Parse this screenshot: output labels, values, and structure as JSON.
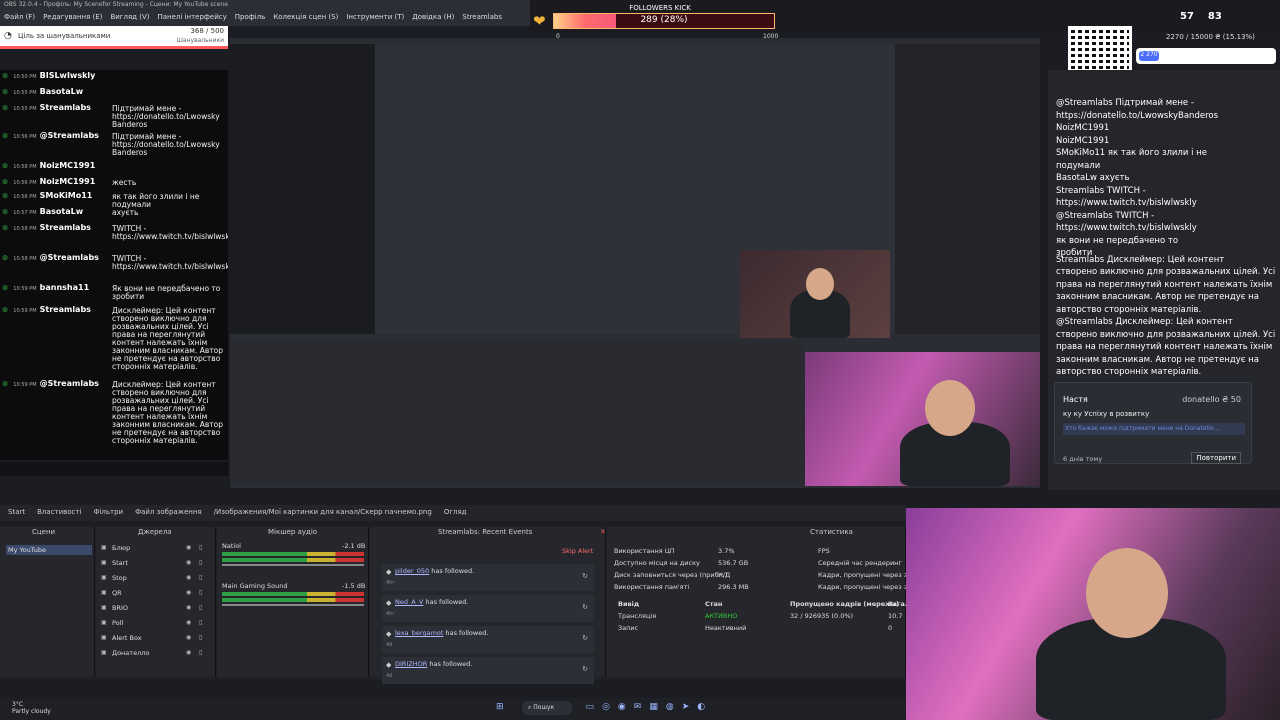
{
  "window": {
    "title": "OBS 32.0.4 - Профіль: My Scenefor Streaming - Сцени: My YouTube scene"
  },
  "menu": [
    "Файл (F)",
    "Редагування (E)",
    "Вигляд (V)",
    "Панелі інтерфейсу",
    "Профіль",
    "Колекція сцен (S)",
    "Інструменти (T)",
    "Довідка (H)",
    "Streamlabs"
  ],
  "followers_kick": {
    "title": "FOLLOWERS KICK",
    "progress_text": "289 (28%)",
    "progress_fraction": 0.28,
    "min": "0",
    "max": "1000"
  },
  "top_stats": {
    "a": "57",
    "b": "83"
  },
  "donation_goal": {
    "text": "2270 / 15000 ₴ (15.13%)",
    "badge": "2 270"
  },
  "sub_goal": {
    "label": "Ціль за шанувальниками",
    "count": "368 / 500",
    "sub": "Шанувальники"
  },
  "chat": [
    {
      "time": "10:50 PM",
      "name": "BISLwIwskly",
      "text": ""
    },
    {
      "time": "10:55 PM",
      "name": "BasotaLw",
      "text": ""
    },
    {
      "time": "10:55 PM",
      "name": "Streamlabs",
      "text": "Підтримай мене - https://donatello.to/Lwowsky Banderos"
    },
    {
      "time": "10:56 PM",
      "name": "@Streamlabs",
      "text": "Підтримай мене - https://donatello.to/Lwowsky Banderos"
    },
    {
      "time": "10:58 PM",
      "name": "NoizMC1991",
      "text": ""
    },
    {
      "time": "10:56 PM",
      "name": "NoizMC1991",
      "text": "жесть"
    },
    {
      "time": "10:56 PM",
      "name": "SMoKiMo11",
      "text": "як так його злили і не подумали"
    },
    {
      "time": "10:57 PM",
      "name": "BasotaLw",
      "text": "ахуєть"
    },
    {
      "time": "10:58 PM",
      "name": "Streamlabs",
      "text": "TWITCH - https://www.twitch.tv/bislwlwskly"
    },
    {
      "time": "10:58 PM",
      "name": "@Streamlabs",
      "text": "TWITCH - https://www.twitch.tv/bislwlwskly"
    },
    {
      "time": "10:59 PM",
      "name": "bannsha11",
      "text": "Як вони не передбачено то зробити"
    },
    {
      "time": "10:59 PM",
      "name": "Streamlabs",
      "text": "Дисклеймер: Цей контент створено виключно для розважальних цілей. Усі права на переглянутий контент належать їхнім законним власникам. Автор не претендує на авторство сторонніх матеріалів."
    },
    {
      "time": "10:59 PM",
      "name": "@Streamlabs",
      "text": "Дисклеймер: Цей контент створено виключно для розважальних цілей. Усі права на переглянутий контент належать їхнім законним власникам. Автор не претендує на авторство сторонніх матеріалів."
    }
  ],
  "right_chat": {
    "lines": [
      "@Streamlabs  Підтримай мене -",
      "https://donatello.to/LwowskyBanderos",
      "NoizMC1991",
      "NoizMC1991",
      "SMoKiMo11  як так його злили і не",
      "подумали",
      "BasotaLw  ахуєть",
      "Streamlabs  TWITCH -",
      "https://www.twitch.tv/bislwlwskly",
      "@Streamlabs  TWITCH -",
      "https://www.twitch.tv/bislwlwskly",
      "як вони не передбачено то",
      "зробити",
      "Streamlabs  Дисклеймер: Цей контент",
      "створено виключно для розважальних цілей. Усі",
      "права на переглянутий контент належать їхнім",
      "законним власникам. Автор не претендує на",
      "авторство сторонніх матеріалів.",
      "@Streamlabs  Дисклеймер: Цей контент",
      "створено виключно для розважальних цілей. Усі",
      "права на переглянутий контент належать їхнім",
      "законним власникам. Автор не претендує на",
      "авторство сторонніх матеріалів."
    ]
  },
  "donation": {
    "name": "Настя",
    "who": "donatello  ₴ 50",
    "message": "ку ку Успіху в розвитку",
    "field": "Хто бажає може підтримати мене на Donatello...",
    "ago": "6 днів тому",
    "repeat": "Повторити"
  },
  "obs_toolbar": {
    "start": "Start",
    "props": "Властивості",
    "filters": "Фільтри",
    "file_label": "Файл зображення",
    "file_path": "/Изображения/Мої картинки для канал/Скерр пачнемо.png",
    "browse": "Огляд"
  },
  "docks": {
    "scenes": "Сцени",
    "sources": "Джерела",
    "mixer": "Мікшер аудіо",
    "events": "Streamlabs: Recent Events",
    "stats": "Статистика"
  },
  "scenes": [
    "My YouTube"
  ],
  "sources": [
    "Блюр",
    "Start",
    "Stop",
    "QR",
    "BRIO",
    "Poll",
    "Alert Box",
    "Донателло"
  ],
  "mixer": [
    {
      "name": "Natiol",
      "db": "-2.1 dB"
    },
    {
      "name": "Main Gaming Sound",
      "db": "-1.5 dB"
    }
  ],
  "events": {
    "skip": "Skip Alert",
    "items": [
      {
        "user": "pilder_050",
        "text": "has followed.",
        "ago": "4hr"
      },
      {
        "user": "Ned_A_V",
        "text": "has followed.",
        "ago": "4hr"
      },
      {
        "user": "lexa_bergamot",
        "text": "has followed.",
        "ago": "4d"
      },
      {
        "user": "DIRIZHOR",
        "text": "has followed.",
        "ago": "4d"
      }
    ]
  },
  "stats": {
    "rows": [
      {
        "label": "Використання ЦП",
        "value": "3.7%"
      },
      {
        "label": "Доступно місця на диску",
        "value": "536.7 GB"
      },
      {
        "label": "Диск заповниться через (прибл.)",
        "value": "Н/Д"
      },
      {
        "label": "Використання пам'яті",
        "value": "296.3 MB"
      }
    ],
    "right": [
      "FPS",
      "Середній час рендеринг",
      "Кадри, пропущені через з",
      "Кадри, пропущені через з"
    ],
    "output_head": [
      "Вивід",
      "Стан",
      "Пропущено кадрів (мережа)",
      "Загал"
    ],
    "output_rows": [
      {
        "name": "Трансляція",
        "state": "АКТИВНО",
        "drop": "32 / 926935 (0.0%)",
        "total": "10.7"
      },
      {
        "name": "Запис",
        "state": "Неактивний",
        "drop": "",
        "total": "0"
      }
    ]
  },
  "taskbar": {
    "weather_temp": "3°C",
    "weather_text": "Partly cloudy",
    "search": "Пошук"
  },
  "colors": {
    "accent": "#f7597a",
    "goal_bar": "#ff5a5a"
  }
}
